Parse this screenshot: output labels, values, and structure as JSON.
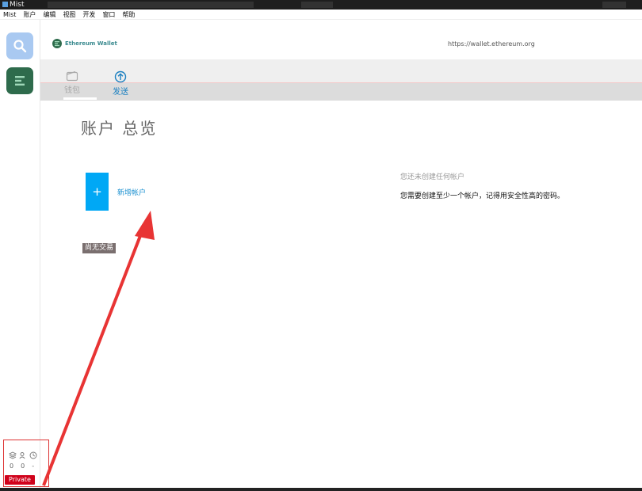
{
  "window": {
    "title": "Mist"
  },
  "menu": {
    "items": [
      "Mist",
      "账户",
      "编辑",
      "视图",
      "开发",
      "窗口",
      "帮助"
    ]
  },
  "header": {
    "brand": "Ethereum Wallet",
    "url": "https://wallet.ethereum.org"
  },
  "tabs": [
    {
      "label": "钱包",
      "icon": "wallet-icon",
      "state": "inactive"
    },
    {
      "label": "发送",
      "icon": "send-circle-icon",
      "state": "active"
    }
  ],
  "main": {
    "title": "账户 总览",
    "add_account_label": "新增帐户",
    "add_symbol": "+",
    "no_transactions": "尚无交易",
    "info_title": "您还未创建任何帐户",
    "info_text": "您需要创建至少一个帐户，记得用安全性高的密码。"
  },
  "status": {
    "peers": "0",
    "blocks": "0",
    "time": "-",
    "network": "Private"
  },
  "colors": {
    "accent": "#00a8f5",
    "private_badge": "#d0021b",
    "annotation": "#e83434"
  }
}
